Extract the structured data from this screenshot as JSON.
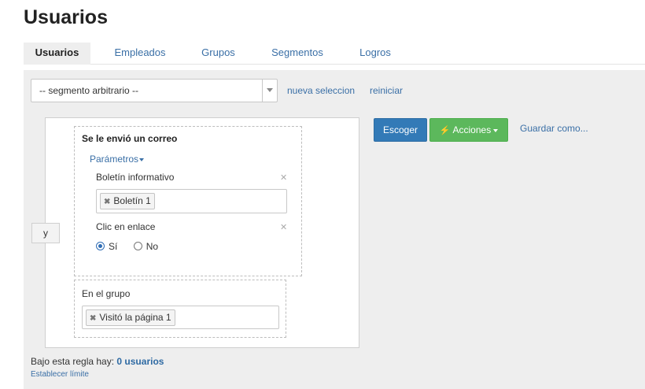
{
  "page": {
    "title": "Usuarios"
  },
  "tabs": [
    {
      "label": "Usuarios",
      "active": true
    },
    {
      "label": "Empleados",
      "active": false
    },
    {
      "label": "Grupos",
      "active": false
    },
    {
      "label": "Segmentos",
      "active": false
    },
    {
      "label": "Logros",
      "active": false
    }
  ],
  "segment": {
    "selected": "-- segmento arbitrario --",
    "new_selection_label": "nueva seleccion",
    "reset_label": "reiniciar"
  },
  "rule": {
    "operator_label": "y",
    "condition1": {
      "title": "Se le envió un correo",
      "params_toggle": "Parámetros",
      "param1": {
        "label": "Boletín informativo",
        "tag": "Boletín 1"
      },
      "param2": {
        "label": "Clic en enlace",
        "options": [
          {
            "label": "Sí",
            "checked": true
          },
          {
            "label": "No",
            "checked": false
          }
        ]
      }
    },
    "condition2": {
      "title": "En el grupo",
      "tag": "Visitó la página 1"
    }
  },
  "actions": {
    "choose_label": "Escoger",
    "actions_label": "Acciones",
    "save_as_label": "Guardar como..."
  },
  "footer": {
    "prefix": "Bajo esta regla hay:",
    "count": "0 usuarios",
    "set_limit": "Establecer límite"
  },
  "colors": {
    "primary": "#337ab7",
    "success": "#5cb85c",
    "link": "#3a6fa6",
    "panel_bg": "#eeeeee"
  }
}
